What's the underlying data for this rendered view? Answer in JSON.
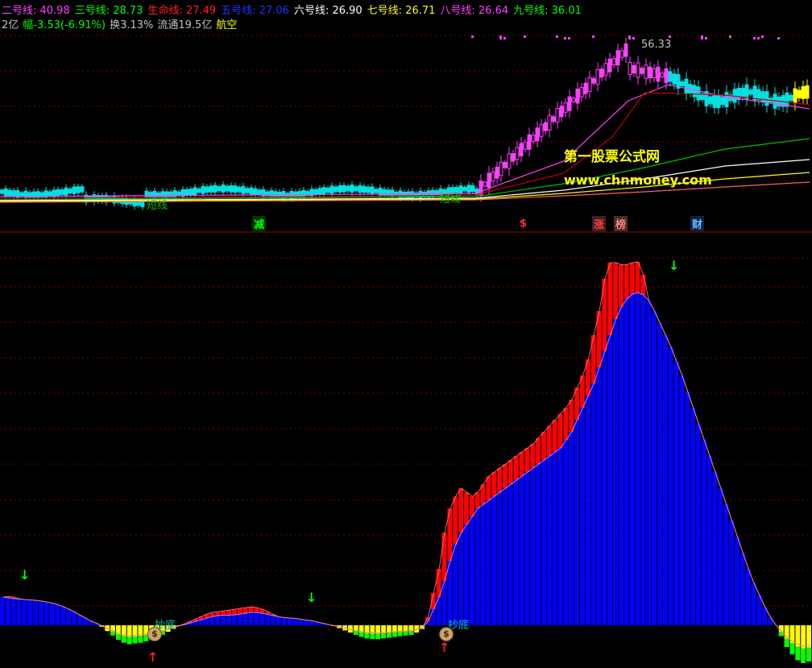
{
  "header": {
    "line1": [
      {
        "label": "二号线:",
        "value": "40.98",
        "color": "#ff40ff"
      },
      {
        "label": "三号线:",
        "value": "28.73",
        "color": "#00ff00"
      },
      {
        "label": "生命线:",
        "value": "27.49",
        "color": "#ff2020"
      },
      {
        "label": "五号线:",
        "value": "27.06",
        "color": "#2030ff"
      },
      {
        "label": "六号线:",
        "value": "26.90",
        "color": "#ffffff"
      },
      {
        "label": "七号线:",
        "value": "26.71",
        "color": "#ffff00"
      },
      {
        "label": "八号线:",
        "value": "26.64",
        "color": "#ff40ff"
      },
      {
        "label": "九号线:",
        "value": "36.01",
        "color": "#00ff00"
      }
    ],
    "line2": [
      {
        "text": "2亿",
        "color": "#c0c0c0"
      },
      {
        "text": "幅-3.53(-6.91%)",
        "color": "#00ff00"
      },
      {
        "text": "换3.13%",
        "color": "#c0c0c0"
      },
      {
        "text": "流通19.5亿",
        "color": "#c0c0c0"
      },
      {
        "text": "航空",
        "color": "#ffff00"
      }
    ]
  },
  "price_chart": {
    "peak_label": "56.33",
    "signal_labels": [
      "短线",
      "短线"
    ],
    "watermark_cn": "第一股票公式网",
    "watermark_url": "www.chnmoney.com"
  },
  "event_tags": [
    {
      "text": "减",
      "color": "#00ff00",
      "bg": "#003300"
    },
    {
      "text": "$",
      "color": "#ff3030",
      "bg": "#000000"
    },
    {
      "text": "涨",
      "color": "#ff4040",
      "bg": "#402020"
    },
    {
      "text": "榜",
      "color": "#ff8080",
      "bg": "#403020"
    },
    {
      "text": "财",
      "color": "#60c0ff",
      "bg": "#102040"
    }
  ],
  "indicator": {
    "bottom_labels": [
      "抄底",
      "抄底"
    ],
    "colors": {
      "red": "#ff0000",
      "blue": "#0000ff",
      "yellow": "#ffff00",
      "green": "#00ff00"
    }
  },
  "chart_data": [
    {
      "type": "line",
      "description_scope": "price candlestick panel",
      "y_max_marker": 56.33,
      "series": [
        {
          "name": "二号线",
          "values": [
            40.98
          ]
        },
        {
          "name": "三号线",
          "values": [
            28.73
          ]
        },
        {
          "name": "生命线",
          "values": [
            27.49
          ]
        },
        {
          "name": "五号线",
          "values": [
            27.06
          ]
        },
        {
          "name": "六号线",
          "values": [
            26.9
          ]
        },
        {
          "name": "七号线",
          "values": [
            26.71
          ]
        },
        {
          "name": "八号线",
          "values": [
            26.64
          ]
        },
        {
          "name": "九号线",
          "values": [
            36.01
          ]
        }
      ]
    },
    {
      "type": "bar",
      "description_scope": "indicator histogram",
      "blue_values": [
        70,
        68,
        66,
        65,
        64,
        63,
        62,
        60,
        58,
        55,
        51,
        46,
        40,
        33,
        25,
        18,
        10,
        5,
        -2,
        -8,
        -14,
        -20,
        -24,
        -26,
        -25,
        -24,
        -22,
        -20,
        -17,
        -13,
        -9,
        -5,
        -1,
        2,
        6,
        10,
        14,
        18,
        22,
        24,
        25,
        25,
        26,
        28,
        30,
        32,
        32,
        30,
        27,
        24,
        21,
        19,
        18,
        17,
        15,
        13,
        11,
        8,
        5,
        2,
        -1,
        -4,
        -7,
        -10,
        -13,
        -16,
        -18,
        -19,
        -19,
        -18,
        -17,
        -16,
        -15,
        -14,
        -13,
        -10,
        -5,
        10,
        40,
        70,
        110,
        160,
        200,
        230,
        250,
        270,
        290,
        300,
        310,
        320,
        330,
        340,
        350,
        360,
        370,
        380,
        390,
        400,
        410,
        420,
        430,
        440,
        460,
        480,
        510,
        540,
        570,
        600,
        640,
        680,
        720,
        760,
        790,
        810,
        822,
        826,
        820,
        805,
        780,
        750,
        720,
        690,
        655,
        620,
        580,
        540,
        500,
        460,
        420,
        380,
        340,
        300,
        260,
        220,
        180,
        140,
        105,
        75,
        45,
        20,
        0,
        -15,
        -30,
        -40,
        -48,
        -52,
        -50
      ],
      "red_values": [
        70,
        72,
        70,
        66,
        64,
        63,
        62,
        60,
        58,
        55,
        51,
        46,
        40,
        33,
        25,
        18,
        10,
        5,
        -2,
        -8,
        -14,
        -20,
        -24,
        -26,
        -25,
        -24,
        -22,
        -20,
        -17,
        -13,
        -9,
        -5,
        -1,
        4,
        10,
        16,
        22,
        28,
        32,
        34,
        36,
        38,
        40,
        42,
        44,
        46,
        44,
        40,
        34,
        27,
        21,
        19,
        18,
        17,
        15,
        13,
        11,
        8,
        5,
        2,
        -1,
        -4,
        -7,
        -10,
        -13,
        -16,
        -18,
        -19,
        -19,
        -18,
        -17,
        -16,
        -15,
        -14,
        -13,
        -10,
        -5,
        20,
        80,
        140,
        230,
        290,
        320,
        340,
        330,
        320,
        330,
        350,
        370,
        380,
        390,
        400,
        410,
        420,
        430,
        440,
        450,
        465,
        480,
        495,
        510,
        525,
        540,
        560,
        590,
        620,
        660,
        720,
        780,
        860,
        900,
        900,
        895,
        895,
        900,
        902,
        870,
        805,
        780,
        750,
        720,
        690,
        655,
        620,
        580,
        540,
        500,
        460,
        420,
        380,
        340,
        300,
        260,
        220,
        180,
        140,
        105,
        75,
        45,
        20,
        0,
        -15,
        -30,
        -40,
        -48,
        -52,
        -50
      ]
    }
  ]
}
